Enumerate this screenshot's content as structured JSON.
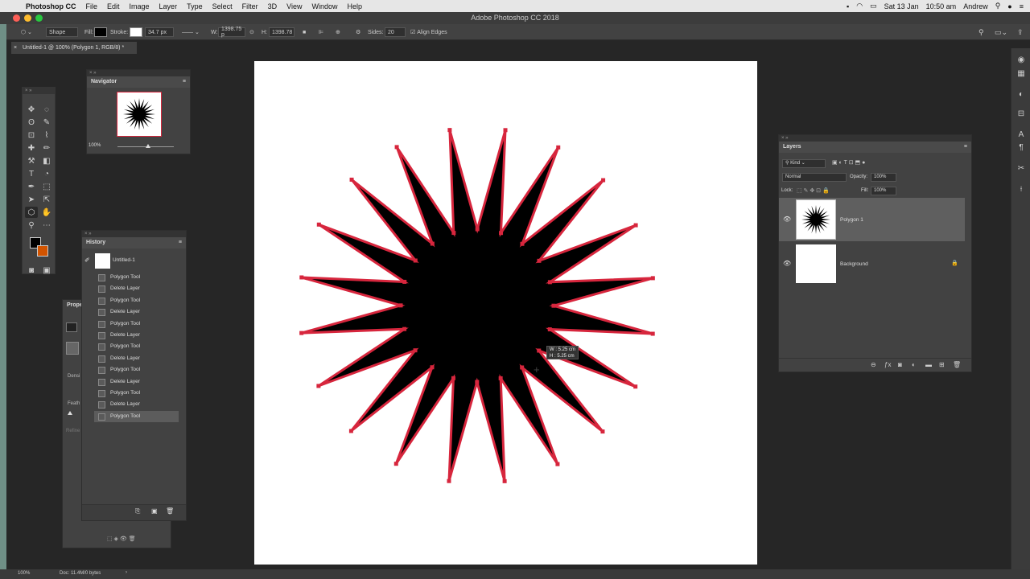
{
  "menubar": {
    "app": "Photoshop CC",
    "items": [
      "File",
      "Edit",
      "Image",
      "Layer",
      "Type",
      "Select",
      "Filter",
      "3D",
      "View",
      "Window",
      "Help"
    ],
    "date": "Sat 13 Jan",
    "time": "10:50 am",
    "user": "Andrew"
  },
  "window": {
    "title": "Adobe Photoshop CC 2018"
  },
  "options": {
    "mode": "Shape",
    "fill_label": "Fill:",
    "fill_color": "#000000",
    "stroke_label": "Stroke:",
    "stroke_width": "34.7 px",
    "w_label": "W:",
    "w_value": "1398.75 p",
    "h_label": "H:",
    "h_value": "1398.78",
    "sides_label": "Sides:",
    "sides_value": "20",
    "align_edges": "Align Edges"
  },
  "document": {
    "tab": "Untitled-1 @ 100% (Polygon 1, RGB/8) *"
  },
  "colors": {
    "foreground": "#000000",
    "background": "#d35400",
    "stroke": "#d7263d"
  },
  "navigator": {
    "title": "Navigator",
    "zoom": "100%"
  },
  "history": {
    "title": "History",
    "snapshot": "Untitled-1",
    "items": [
      "Polygon Tool",
      "Delete Layer",
      "Polygon Tool",
      "Delete Layer",
      "Polygon Tool",
      "Delete Layer",
      "Polygon Tool",
      "Delete Layer",
      "Polygon Tool",
      "Delete Layer",
      "Polygon Tool",
      "Delete Layer",
      "Polygon Tool"
    ]
  },
  "properties": {
    "title": "Prope",
    "density": "Densi",
    "feather": "Feath",
    "refine": "Refine"
  },
  "layers": {
    "title": "Layers",
    "kind": "Kind",
    "blend": "Normal",
    "opacity_label": "Opacity:",
    "opacity": "100%",
    "lock_label": "Lock:",
    "fill_label": "Fill:",
    "fill": "100%",
    "rows": [
      {
        "name": "Polygon 1",
        "selected": true
      },
      {
        "name": "Background",
        "selected": false
      }
    ]
  },
  "readout": {
    "w": "W : 5.25 cm",
    "h": "H : 5.25 cm"
  },
  "status": {
    "zoom": "100%",
    "doc": "Doc: 11.4M/0 bytes"
  }
}
